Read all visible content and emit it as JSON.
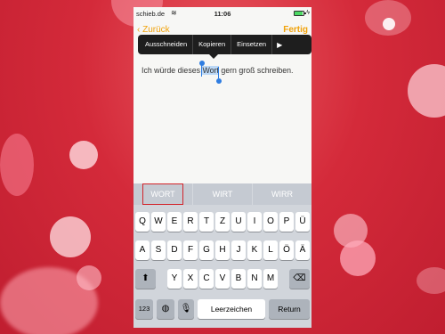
{
  "status_bar": {
    "carrier": "schieb.de",
    "time": "11:06"
  },
  "nav": {
    "back_label": "Zurück",
    "done_label": "Fertig"
  },
  "edit_menu": {
    "items": [
      "Ausschneiden",
      "Kopieren",
      "Einsetzen"
    ]
  },
  "editor": {
    "text_before": "Ich würde dieses ",
    "selected_word": "Wort",
    "text_after": " gern groß schreiben."
  },
  "suggestions": [
    "WORT",
    "WIRT",
    "WIRR"
  ],
  "keyboard": {
    "row1": [
      "Q",
      "W",
      "E",
      "R",
      "T",
      "Z",
      "U",
      "I",
      "O",
      "P",
      "Ü"
    ],
    "row2": [
      "A",
      "S",
      "D",
      "F",
      "G",
      "H",
      "J",
      "K",
      "L",
      "Ö",
      "Ä"
    ],
    "row3": [
      "Y",
      "X",
      "C",
      "V",
      "B",
      "N",
      "M"
    ],
    "numbers_label": "123",
    "space_label": "Leerzeichen",
    "return_label": "Return"
  }
}
